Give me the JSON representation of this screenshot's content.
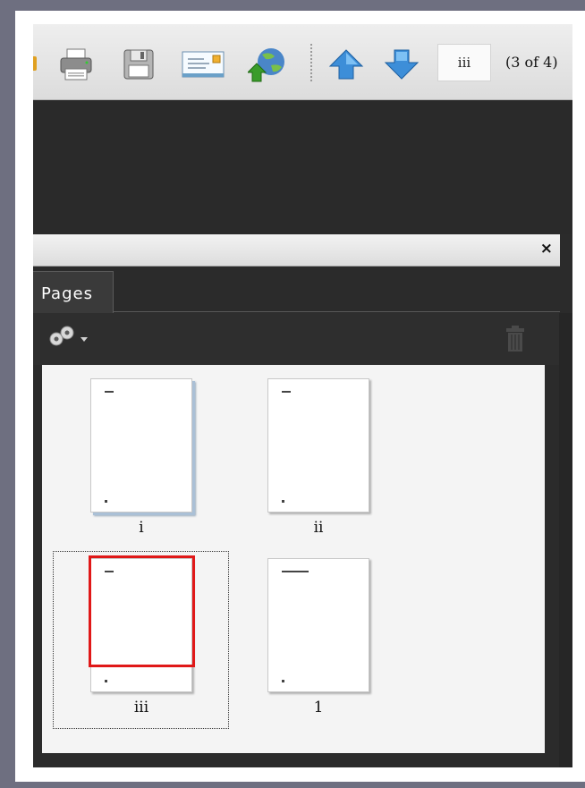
{
  "toolbar": {
    "buttons": [
      {
        "name": "print-icon",
        "color": "#5a5a5a"
      },
      {
        "name": "save-icon",
        "color": "#666666"
      },
      {
        "name": "email-icon",
        "color": "#6aa0c8"
      },
      {
        "name": "upload-globe-icon",
        "color": "#3a8c2a"
      },
      {
        "name": "previous-page-icon",
        "color": "#3d8ed8"
      },
      {
        "name": "next-page-icon",
        "color": "#3d8ed8"
      }
    ],
    "page_input_value": "iii",
    "page_count": "(3 of 4)"
  },
  "panel": {
    "close_symbol": "×",
    "tab_label": "Pages",
    "options_icon": "gear-icon",
    "delete_icon": "trash-icon"
  },
  "pages": [
    {
      "label": "i",
      "selected": false
    },
    {
      "label": "ii",
      "selected": false
    },
    {
      "label": "iii",
      "selected": true
    },
    {
      "label": "1",
      "selected": false
    }
  ],
  "colors": {
    "selection": "#e01818",
    "frame": "#6e6f80"
  }
}
